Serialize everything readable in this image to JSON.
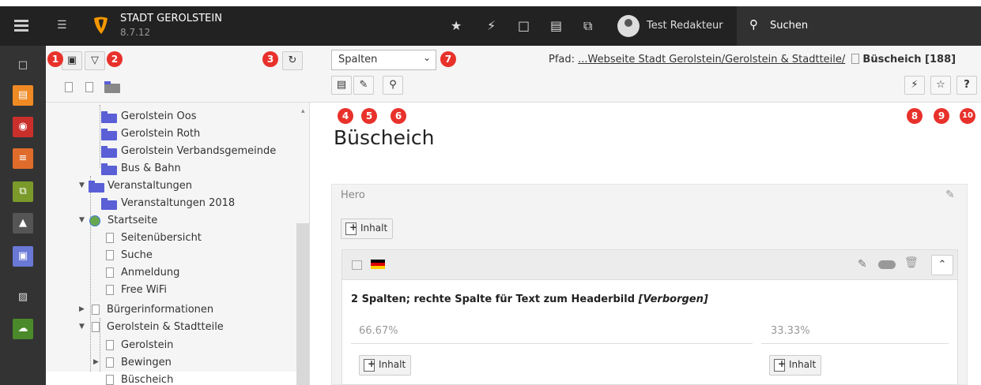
{
  "topbar": {
    "site_name": "STADT GEROLSTEIN",
    "version": "8.7.12",
    "user_name": "Test Redakteur",
    "search_label": "Suchen",
    "icons": [
      "star-icon",
      "flash-icon",
      "page-icon",
      "list-icon",
      "copy-icon"
    ]
  },
  "modules": [
    {
      "name": "page-module",
      "color": "#333333",
      "glyph": "☐"
    },
    {
      "name": "list-module",
      "color": "#f08a24",
      "glyph": "▤"
    },
    {
      "name": "view-module",
      "color": "#c33",
      "glyph": "◉"
    },
    {
      "name": "records-module",
      "color": "#e06c2c",
      "glyph": "≡"
    },
    {
      "name": "workspaces-module",
      "color": "#7a9a2a",
      "glyph": "⧉"
    },
    {
      "name": "recycler-module",
      "color": "#555",
      "glyph": "✖"
    },
    {
      "name": "form-module",
      "color": "#6a78d6",
      "glyph": "▣"
    },
    {
      "name": "filelist-module",
      "color": "#333333",
      "glyph": "▨"
    },
    {
      "name": "cloud-module",
      "color": "#5a9a2a",
      "glyph": "☁"
    }
  ],
  "badges": [
    "1",
    "2",
    "3",
    "4",
    "5",
    "6",
    "7",
    "8",
    "9",
    "10"
  ],
  "tree": {
    "nodes": [
      {
        "label": "Gerolstein Oos",
        "type": "folder"
      },
      {
        "label": "Gerolstein Roth",
        "type": "folder"
      },
      {
        "label": "Gerolstein Verbandsgemeinde",
        "type": "folder"
      },
      {
        "label": "Bus & Bahn",
        "type": "folder"
      },
      {
        "label": "Veranstaltungen",
        "type": "folder"
      },
      {
        "label": "Veranstaltungen 2018",
        "type": "folder"
      },
      {
        "label": "Startseite",
        "type": "globe"
      },
      {
        "label": "Seitenübersicht",
        "type": "page"
      },
      {
        "label": "Suche",
        "type": "page"
      },
      {
        "label": "Anmeldung",
        "type": "page"
      },
      {
        "label": "Free WiFi",
        "type": "page"
      },
      {
        "label": "Bürgerinformationen",
        "type": "page"
      },
      {
        "label": "Gerolstein & Stadtteile",
        "type": "page"
      },
      {
        "label": "Gerolstein",
        "type": "page"
      },
      {
        "label": "Bewingen",
        "type": "page"
      },
      {
        "label": "Büscheich",
        "type": "page"
      }
    ]
  },
  "doc_header": {
    "view_select": "Spalten",
    "path_prefix": "Pfad: ",
    "path_link": "...Webseite Stadt Gerolstein/Gerolstein & Stadtteile/",
    "current_page": "Büscheich [188]"
  },
  "content": {
    "page_title": "Büscheich",
    "hero_label": "Hero",
    "add_content_label": "Inhalt",
    "element_title": "2 Spalten; rechte Spalte für Text zum Headerbild ",
    "element_hidden": "[Verborgen]",
    "col1_label": "66.67%",
    "col2_label": "33.33%"
  }
}
